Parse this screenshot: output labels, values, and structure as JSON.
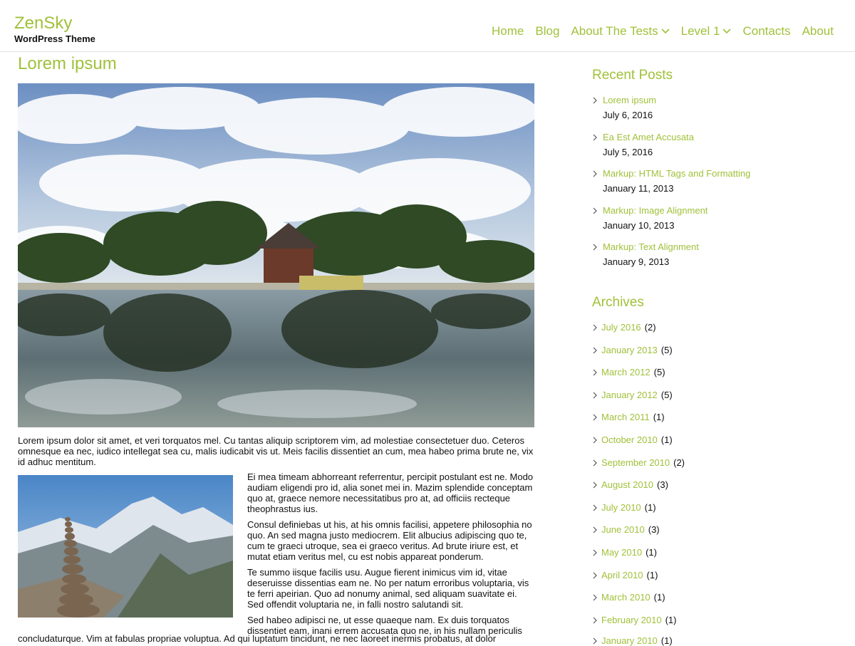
{
  "site": {
    "title": "ZenSky",
    "tagline": "WordPress Theme"
  },
  "nav": [
    {
      "label": "Home",
      "has_dropdown": false
    },
    {
      "label": "Blog",
      "has_dropdown": false
    },
    {
      "label": "About The Tests",
      "has_dropdown": true
    },
    {
      "label": "Level 1",
      "has_dropdown": true
    },
    {
      "label": "Contacts",
      "has_dropdown": false
    },
    {
      "label": "About",
      "has_dropdown": false
    }
  ],
  "post": {
    "title": "Lorem ipsum",
    "intro": "Lorem ipsum dolor sit amet, et veri torquatos mel. Cu tantas aliquip scriptorem vim, ad molestiae consectetuer duo. Ceteros omnesque ea nec, iudico intellegat sea cu, malis iudicabit vis ut. Meis facilis dissentiet an cum, mea habeo prima brute ne, vix id adhuc mentitum.",
    "paragraphs": [
      "Ei mea timeam abhorreant referrentur, percipit postulant est ne. Modo audiam eligendi pro id, alia sonet mei in. Mazim splendide conceptam quo at, graece nemore necessitatibus pro at, ad officiis recteque theophrastus ius.",
      "Consul definiebas ut his, at his omnis facilisi, appetere philosophia no quo. An sed magna justo mediocrem. Elit albucius adipiscing quo te, cum te graeci utroque, sea ei graeco veritus. Ad brute iriure est, et mutat etiam veritus mel, cu est nobis appareat ponderum.",
      "Te summo iisque facilis usu. Augue fierent inimicus vim id, vitae deseruisse dissentias eam ne. No per natum erroribus voluptaria, vis te ferri apeirian. Quo ad nonumy animal, sed aliquam suavitate ei. Sed offendit voluptaria ne, in falli nostro salutandi sit.",
      "Sed habeo adipisci ne, ut esse quaeque nam. Ex duis torquatos dissentiet eam, inani errem accusata quo ne, in his nullam periculis"
    ],
    "tail": "concludaturque. Vim at fabulas propriae voluptua. Ad qui luptatum tincidunt, ne nec laoreet inermis probatus, at dolor"
  },
  "sidebar": {
    "recent_heading": "Recent Posts",
    "recent": [
      {
        "title": "Lorem ipsum",
        "date": "July 6, 2016"
      },
      {
        "title": "Ea Est Amet Accusata",
        "date": "July 5, 2016"
      },
      {
        "title": "Markup: HTML Tags and Formatting",
        "date": "January 11, 2013"
      },
      {
        "title": "Markup: Image Alignment",
        "date": "January 10, 2013"
      },
      {
        "title": "Markup: Text Alignment",
        "date": "January 9, 2013"
      }
    ],
    "archives_heading": "Archives",
    "archives": [
      {
        "label": "July 2016",
        "count": "(2)"
      },
      {
        "label": "January 2013",
        "count": "(5)"
      },
      {
        "label": "March 2012",
        "count": "(5)"
      },
      {
        "label": "January 2012",
        "count": "(5)"
      },
      {
        "label": "March 2011",
        "count": "(1)"
      },
      {
        "label": "October 2010",
        "count": "(1)"
      },
      {
        "label": "September 2010",
        "count": "(2)"
      },
      {
        "label": "August 2010",
        "count": "(3)"
      },
      {
        "label": "July 2010",
        "count": "(1)"
      },
      {
        "label": "June 2010",
        "count": "(3)"
      },
      {
        "label": "May 2010",
        "count": "(1)"
      },
      {
        "label": "April 2010",
        "count": "(1)"
      },
      {
        "label": "March 2010",
        "count": "(1)"
      },
      {
        "label": "February 2010",
        "count": "(1)"
      },
      {
        "label": "January 2010",
        "count": "(1)"
      }
    ]
  },
  "colors": {
    "accent": "#a0c13a",
    "text": "#111111",
    "border": "#e0e0e0"
  }
}
